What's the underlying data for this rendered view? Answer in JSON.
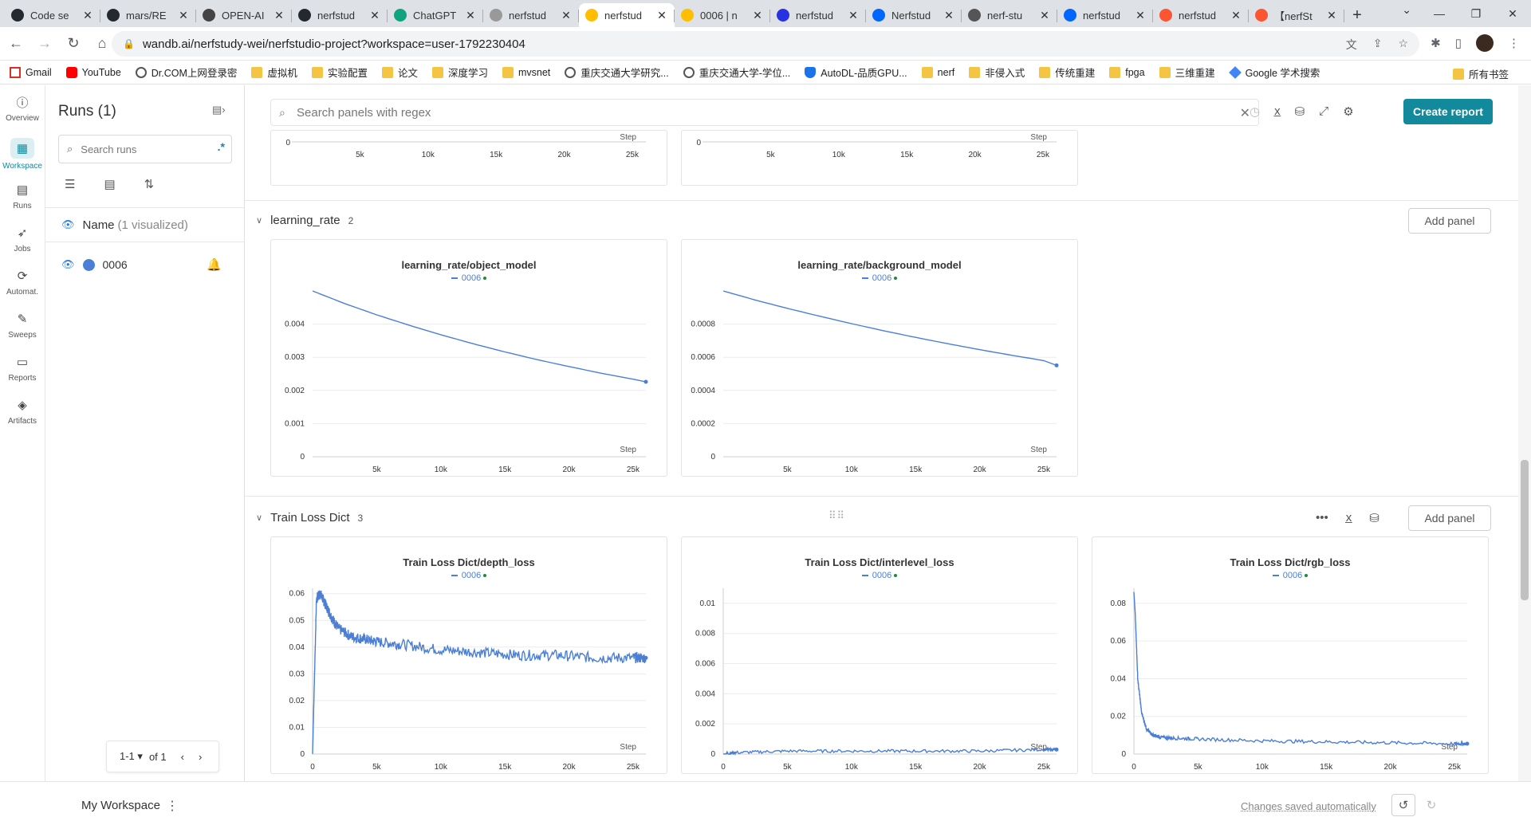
{
  "browser": {
    "tabs": [
      {
        "title": "Code se",
        "icon": "github-icon",
        "color": "#24292f"
      },
      {
        "title": "mars/RE",
        "icon": "github-icon",
        "color": "#24292f"
      },
      {
        "title": "OPEN-AI",
        "icon": "openai-icon",
        "color": "#444444"
      },
      {
        "title": "nerfstud",
        "icon": "github-icon",
        "color": "#24292f"
      },
      {
        "title": "ChatGPT",
        "icon": "chatgpt-icon",
        "color": "#10a37f"
      },
      {
        "title": "nerfstud",
        "icon": "loading-icon",
        "color": "#999999"
      },
      {
        "title": "nerfstud",
        "icon": "wandb-icon",
        "color": "#ffbe00",
        "active": true
      },
      {
        "title": "0006 | n",
        "icon": "wandb-icon",
        "color": "#ffbe00"
      },
      {
        "title": "nerfstud",
        "icon": "baidu-icon",
        "color": "#2932e1"
      },
      {
        "title": "Nerfstud",
        "icon": "zhihu-icon",
        "color": "#0066ff"
      },
      {
        "title": "nerf-stu",
        "icon": "globe-icon",
        "color": "#555555"
      },
      {
        "title": "nerfstud",
        "icon": "zhihu-icon",
        "color": "#0066ff"
      },
      {
        "title": "nerfstud",
        "icon": "csdn-icon",
        "color": "#fc5531"
      },
      {
        "title": "【nerfSt",
        "icon": "csdn-icon",
        "color": "#fc5531"
      }
    ],
    "url": "wandb.ai/nerfstudy-wei/nerfstudio-project?workspace=user-1792230404",
    "bookmarks": [
      {
        "label": "Gmail",
        "icon": "gmail"
      },
      {
        "label": "YouTube",
        "icon": "yt"
      },
      {
        "label": "Dr.COM上网登录密",
        "icon": "globe"
      },
      {
        "label": "虚拟机",
        "icon": "folder"
      },
      {
        "label": "实验配置",
        "icon": "folder"
      },
      {
        "label": "论文",
        "icon": "folder"
      },
      {
        "label": "深度学习",
        "icon": "folder"
      },
      {
        "label": "mvsnet",
        "icon": "folder"
      },
      {
        "label": "重庆交通大学研究...",
        "icon": "globe"
      },
      {
        "label": "重庆交通大学-学位...",
        "icon": "globe"
      },
      {
        "label": "AutoDL-品质GPU...",
        "icon": "shield"
      },
      {
        "label": "nerf",
        "icon": "folder"
      },
      {
        "label": "非侵入式",
        "icon": "folder"
      },
      {
        "label": "传统重建",
        "icon": "folder"
      },
      {
        "label": "fpga",
        "icon": "folder"
      },
      {
        "label": "三维重建",
        "icon": "folder"
      },
      {
        "label": "Google 学术搜索",
        "icon": "gscholar"
      }
    ],
    "all_bookmarks": "所有书签"
  },
  "nav": [
    {
      "label": "Overview",
      "icon": "info-icon"
    },
    {
      "label": "Workspace",
      "icon": "workspace-icon",
      "active": true
    },
    {
      "label": "Runs",
      "icon": "table-icon"
    },
    {
      "label": "Jobs",
      "icon": "rocket-icon"
    },
    {
      "label": "Automat.",
      "icon": "automation-icon"
    },
    {
      "label": "Sweeps",
      "icon": "broom-icon"
    },
    {
      "label": "Reports",
      "icon": "document-icon"
    },
    {
      "label": "Artifacts",
      "icon": "layers-icon"
    }
  ],
  "runs": {
    "title": "Runs (1)",
    "search_placeholder": "Search runs",
    "regex": ".*",
    "name_header": "Name",
    "visualized": "(1 visualized)",
    "rows": [
      {
        "name": "0006",
        "color": "#4a7fd5"
      }
    ],
    "pager": {
      "range": "1-1",
      "of": "of 1"
    }
  },
  "main": {
    "search_placeholder": "Search panels with regex",
    "create_report": "Create report",
    "add_panel": "Add panel",
    "step_label": "Step",
    "sections": [
      {
        "name": "learning_rate",
        "count": "2"
      },
      {
        "name": "Train Loss Dict",
        "count": "3"
      }
    ]
  },
  "chart_data": [
    {
      "type": "line",
      "title": "",
      "xlabel": "Step",
      "xticks": [
        "5k",
        "10k",
        "15k",
        "20k",
        "25k"
      ],
      "yticks": [
        "0"
      ],
      "note": "partially visible panel at top (left)"
    },
    {
      "type": "line",
      "title": "",
      "xlabel": "Step",
      "xticks": [
        "5k",
        "10k",
        "15k",
        "20k",
        "25k"
      ],
      "yticks": [
        "0"
      ],
      "note": "partially visible panel at top (right)"
    },
    {
      "type": "line",
      "title": "learning_rate/object_model",
      "series": [
        {
          "name": "0006",
          "color": "#4a7fd5",
          "x": [
            0,
            2500,
            5000,
            7500,
            10000,
            12500,
            15000,
            17500,
            20000,
            22500,
            25000,
            26000
          ],
          "y": [
            0.005,
            0.00462,
            0.00428,
            0.00397,
            0.00368,
            0.00341,
            0.00316,
            0.00293,
            0.00272,
            0.00252,
            0.00234,
            0.00226
          ]
        }
      ],
      "xlabel": "Step",
      "xlim": [
        0,
        26000
      ],
      "ylim": [
        0,
        0.005
      ],
      "xticks": [
        "5k",
        "10k",
        "15k",
        "20k",
        "25k"
      ],
      "xtick_values": [
        5000,
        10000,
        15000,
        20000,
        25000
      ],
      "yticks": [
        "0",
        "0.001",
        "0.002",
        "0.003",
        "0.004"
      ],
      "ytick_values": [
        0,
        0.001,
        0.002,
        0.003,
        0.004
      ]
    },
    {
      "type": "line",
      "title": "learning_rate/background_model",
      "series": [
        {
          "name": "0006",
          "color": "#4a7fd5",
          "x": [
            0,
            2500,
            5000,
            7500,
            10000,
            12500,
            15000,
            17500,
            20000,
            22500,
            25000,
            26000
          ],
          "y": [
            0.001,
            0.000945,
            0.000895,
            0.000848,
            0.000803,
            0.00076,
            0.00072,
            0.000682,
            0.000646,
            0.000612,
            0.00058,
            0.000551
          ]
        }
      ],
      "xlabel": "Step",
      "xlim": [
        0,
        26000
      ],
      "ylim": [
        0,
        0.001
      ],
      "xticks": [
        "5k",
        "10k",
        "15k",
        "20k",
        "25k"
      ],
      "xtick_values": [
        5000,
        10000,
        15000,
        20000,
        25000
      ],
      "yticks": [
        "0",
        "0.0002",
        "0.0004",
        "0.0006",
        "0.0008"
      ],
      "ytick_values": [
        0,
        0.0002,
        0.0004,
        0.0006,
        0.0008
      ]
    },
    {
      "type": "line",
      "title": "Train Loss Dict/depth_loss",
      "series": [
        {
          "name": "0006",
          "color": "#4a7fd5",
          "x": [
            0,
            300,
            600,
            1000,
            1500,
            2000,
            3000,
            4000,
            5000,
            7000,
            10000,
            13000,
            16000,
            19000,
            22000,
            25000,
            26000
          ],
          "y": [
            0.0,
            0.058,
            0.06,
            0.056,
            0.051,
            0.047,
            0.044,
            0.043,
            0.042,
            0.041,
            0.039,
            0.038,
            0.037,
            0.037,
            0.036,
            0.036,
            0.036
          ]
        }
      ],
      "xlabel": "Step",
      "xlim": [
        0,
        26000
      ],
      "ylim": [
        0,
        0.062
      ],
      "xticks": [
        "0",
        "5k",
        "10k",
        "15k",
        "20k",
        "25k"
      ],
      "xtick_values": [
        0,
        5000,
        10000,
        15000,
        20000,
        25000
      ],
      "yticks": [
        "0",
        "0.01",
        "0.02",
        "0.03",
        "0.04",
        "0.05",
        "0.06"
      ],
      "ytick_values": [
        0,
        0.01,
        0.02,
        0.03,
        0.04,
        0.05,
        0.06
      ]
    },
    {
      "type": "line",
      "title": "Train Loss Dict/interlevel_loss",
      "series": [
        {
          "name": "0006",
          "color": "#4a7fd5",
          "x": [
            0,
            1000,
            5000,
            10000,
            15000,
            20000,
            25000,
            26000
          ],
          "y": [
            0.0,
            0.0001,
            0.0002,
            0.0002,
            0.0002,
            0.0002,
            0.0003,
            0.0003
          ]
        }
      ],
      "xlabel": "Step",
      "xlim": [
        0,
        26000
      ],
      "ylim": [
        0,
        0.011
      ],
      "xticks": [
        "0",
        "5k",
        "10k",
        "15k",
        "20k",
        "25k"
      ],
      "xtick_values": [
        0,
        5000,
        10000,
        15000,
        20000,
        25000
      ],
      "yticks": [
        "0",
        "0.002",
        "0.004",
        "0.006",
        "0.008",
        "0.01"
      ],
      "ytick_values": [
        0,
        0.002,
        0.004,
        0.006,
        0.008,
        0.01
      ]
    },
    {
      "type": "line",
      "title": "Train Loss Dict/rgb_loss",
      "series": [
        {
          "name": "0006",
          "color": "#4a7fd5",
          "x": [
            0,
            100,
            300,
            600,
            1000,
            1500,
            2000,
            3000,
            5000,
            10000,
            15000,
            20000,
            25000,
            26000
          ],
          "y": [
            0.086,
            0.075,
            0.04,
            0.022,
            0.013,
            0.01,
            0.009,
            0.0085,
            0.008,
            0.007,
            0.0065,
            0.006,
            0.0055,
            0.0055
          ]
        }
      ],
      "xlabel": "Step",
      "xlim": [
        0,
        26000
      ],
      "ylim": [
        0,
        0.088
      ],
      "xticks": [
        "0",
        "5k",
        "10k",
        "15k",
        "20k",
        "25k"
      ],
      "xtick_values": [
        0,
        5000,
        10000,
        15000,
        20000,
        25000
      ],
      "yticks": [
        "0",
        "0.02",
        "0.04",
        "0.06",
        "0.08"
      ],
      "ytick_values": [
        0,
        0.02,
        0.04,
        0.06,
        0.08
      ]
    }
  ],
  "footer": {
    "workspace": "My Workspace",
    "saved": "Changes saved automatically"
  }
}
